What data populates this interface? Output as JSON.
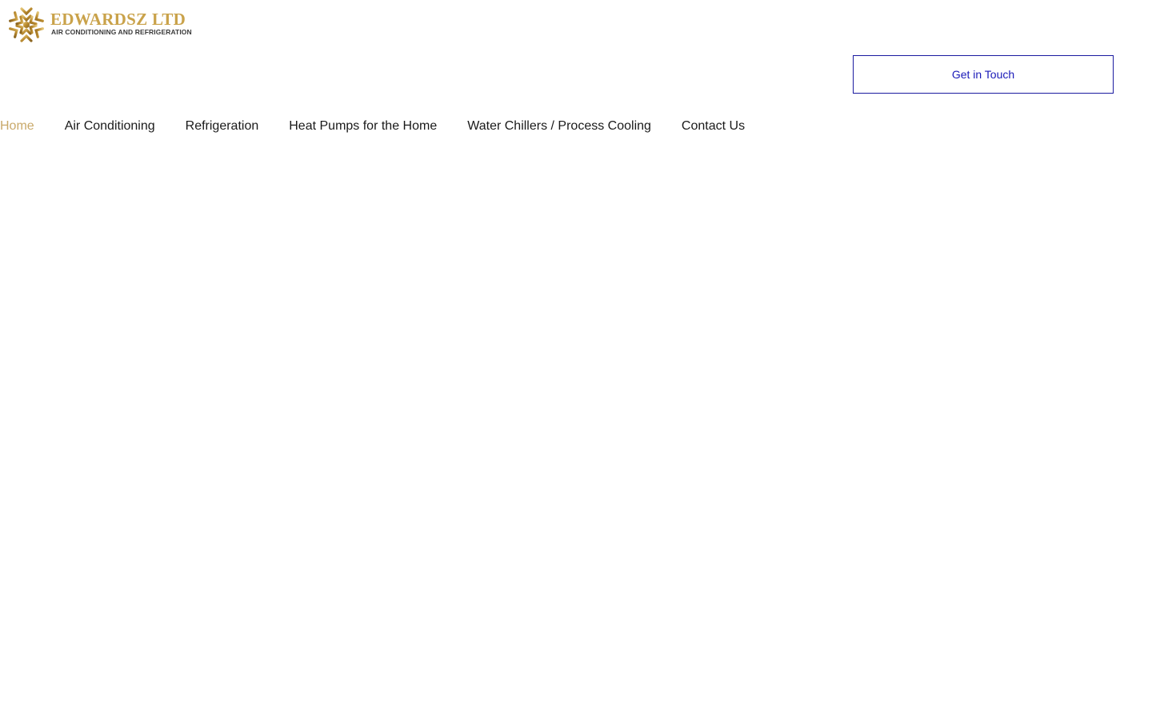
{
  "logo": {
    "name": "EDWARDSZ LTD",
    "tagline": "AIR CONDITIONING AND REFRIGERATION",
    "icon": "snowflake-icon"
  },
  "header": {
    "cta_label": "Get in Touch"
  },
  "nav": {
    "items": [
      {
        "label": "Home",
        "active": true
      },
      {
        "label": "Air Conditioning",
        "active": false
      },
      {
        "label": "Refrigeration",
        "active": false
      },
      {
        "label": "Heat Pumps for the Home",
        "active": false
      },
      {
        "label": "Water Chillers / Process Cooling",
        "active": false
      },
      {
        "label": "Contact Us",
        "active": false
      }
    ]
  },
  "colors": {
    "brand_gold": "#c9a24a",
    "nav_active": "#c9a96a",
    "cta_border": "#1a1aa0",
    "cta_text": "#1a1ab8",
    "nav_text": "#1a1a1a",
    "background": "#ffffff"
  }
}
